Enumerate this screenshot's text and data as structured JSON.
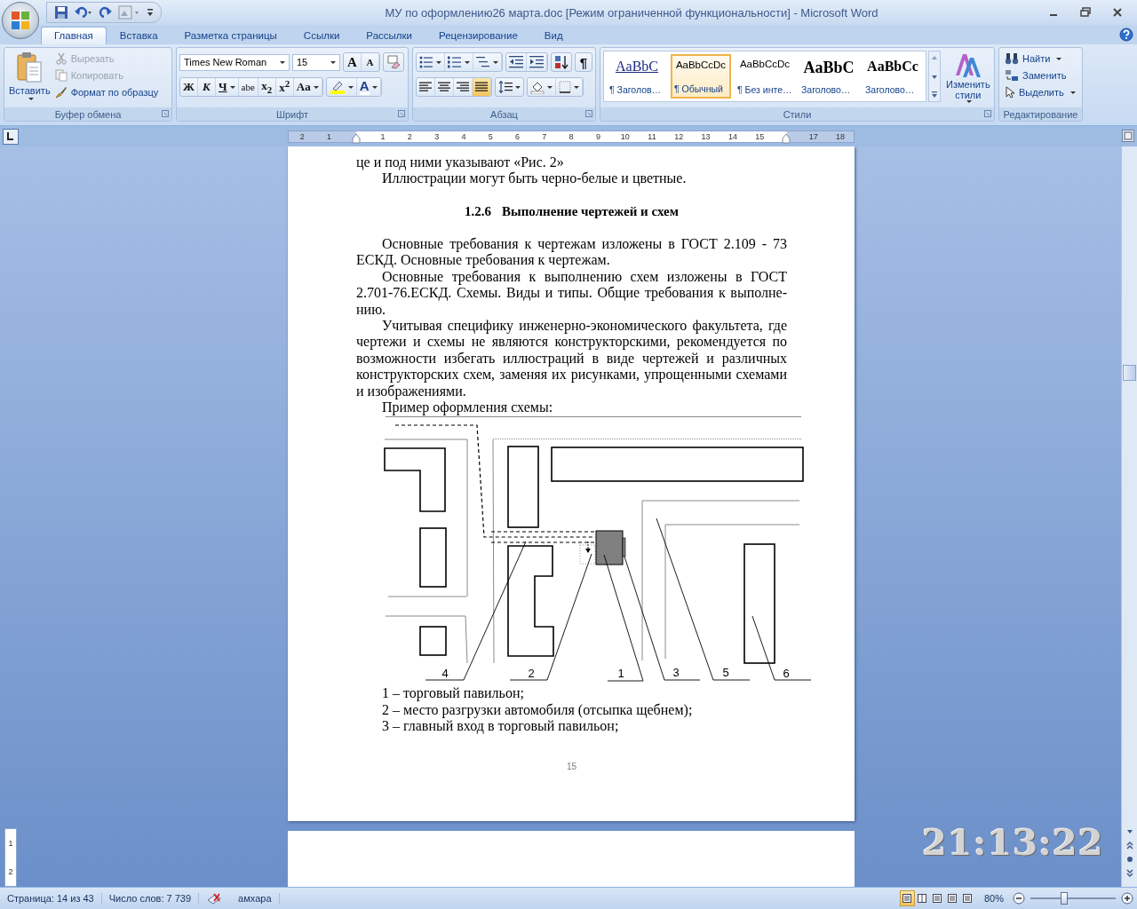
{
  "window": {
    "title": "МУ по оформлению26 марта.doc [Режим ограниченной функциональности] - Microsoft Word"
  },
  "tabs": [
    {
      "label": "Главная",
      "selected": true
    },
    {
      "label": "Вставка",
      "selected": false
    },
    {
      "label": "Разметка страницы",
      "selected": false
    },
    {
      "label": "Ссылки",
      "selected": false
    },
    {
      "label": "Рассылки",
      "selected": false
    },
    {
      "label": "Рецензирование",
      "selected": false
    },
    {
      "label": "Вид",
      "selected": false
    }
  ],
  "ribbon": {
    "clipboard": {
      "title": "Буфер обмена",
      "paste": "Вставить",
      "items": [
        {
          "label": "Вырезать",
          "kind": "cut",
          "disabled": true
        },
        {
          "label": "Копировать",
          "kind": "copy",
          "disabled": true
        },
        {
          "label": "Формат по образцу",
          "kind": "brush",
          "disabled": false
        }
      ]
    },
    "font": {
      "title": "Шрифт",
      "font_name": "Times New Roman",
      "font_size": "15",
      "size_buttons": [
        "A",
        "A"
      ],
      "format_buttons": [
        {
          "label": "Ж",
          "kind": "bold"
        },
        {
          "label": "К",
          "kind": "italic"
        },
        {
          "label": "Ч",
          "kind": "underline"
        },
        {
          "label": "abe",
          "kind": "strike"
        },
        {
          "label": "x$_{2}$",
          "kind": "sub"
        },
        {
          "label": "x$^{2}$",
          "kind": "sup"
        },
        {
          "label": "Aa",
          "kind": "case"
        }
      ],
      "color_button": "A"
    },
    "paragraph": {
      "title": "Абзац",
      "pilcrow": "¶",
      "alignment": [
        {
          "kind": "left",
          "selected": false
        },
        {
          "kind": "center",
          "selected": false
        },
        {
          "kind": "right",
          "selected": false
        },
        {
          "kind": "justify",
          "selected": true
        }
      ]
    },
    "styles": {
      "title": "Стили",
      "items": [
        {
          "sample": "AaBbC",
          "name": "¶ Заголов…",
          "kind": "heading1",
          "selected": false
        },
        {
          "sample": "AaBbCcDc",
          "name": "¶ Обычный",
          "kind": "normal",
          "selected": true
        },
        {
          "sample": "AaBbCcDc",
          "name": "¶ Без инте…",
          "kind": "normal",
          "selected": false
        },
        {
          "sample": "AaBbC",
          "name": "Заголово…",
          "kind": "heading2",
          "selected": false
        },
        {
          "sample": "AaBbCc",
          "name": "Заголово…",
          "kind": "heading3",
          "selected": false
        }
      ],
      "change_styles": "Изменить стили"
    },
    "editing": {
      "title": "Редактирование",
      "items": [
        {
          "label": "Найти",
          "kind": "find"
        },
        {
          "label": "Заменить",
          "kind": "replace"
        },
        {
          "label": "Выделить",
          "kind": "select"
        }
      ]
    }
  },
  "ruler": {
    "marks": [
      {
        "kind": "number",
        "label": "2"
      },
      {
        "kind": "number",
        "label": "1"
      },
      {
        "kind": "marker"
      },
      {
        "kind": "number",
        "label": "1"
      },
      {
        "kind": "number",
        "label": "2"
      },
      {
        "kind": "number",
        "label": "3"
      },
      {
        "kind": "number",
        "label": "4"
      },
      {
        "kind": "number",
        "label": "5"
      },
      {
        "kind": "number",
        "label": "6"
      },
      {
        "kind": "number",
        "label": "7"
      },
      {
        "kind": "number",
        "label": "8"
      },
      {
        "kind": "number",
        "label": "9"
      },
      {
        "kind": "number",
        "label": "10"
      },
      {
        "kind": "number",
        "label": "11"
      },
      {
        "kind": "number",
        "label": "12"
      },
      {
        "kind": "number",
        "label": "13"
      },
      {
        "kind": "number",
        "label": "14"
      },
      {
        "kind": "number",
        "label": "15"
      },
      {
        "kind": "marker"
      },
      {
        "kind": "number",
        "label": "17"
      },
      {
        "kind": "number",
        "label": "18"
      }
    ]
  },
  "document": {
    "paragraphs": [
      {
        "text": "це и под ними указывают «Рис. 2»",
        "indent": false
      },
      {
        "text": "Иллюстрации могут быть черно-белые и цветные.",
        "indent": true
      }
    ],
    "heading": {
      "number": "1.2.6",
      "title": "Выполнение чертежей и схем"
    },
    "body": [
      {
        "text": "Основные требования к чертежам изложены в ГОСТ 2.109 - 73 ЕСКД. Основные требования к чертежам.",
        "indent": true
      },
      {
        "text": "Основные требования к выполнению схем изложены в ГОСТ 2.701-76.ЕСКД. Схемы. Виды и типы. Общие требования к выполне-нию.",
        "indent": true
      },
      {
        "text": "Учитывая специфику инженерно-экономического факультета, где чертежи и схемы не являются конструкторскими, рекомендуется по возможности избегать иллюстраций в виде чертежей и различных конструкторских схем, заменяя их рисунками, упрощенными схемами и изображениями.",
        "indent": true
      },
      {
        "text": "Пример оформления схемы:",
        "indent": true
      }
    ],
    "diagram": {
      "labels": [
        "4",
        "2",
        "1",
        "3",
        "5",
        "6"
      ]
    },
    "legend": [
      "1 – торговый павильон;",
      "2 – место разгрузки автомобиля (отсыпка щебнем);",
      "3 – главный вход в торговый павильон;"
    ],
    "page_number": "15"
  },
  "vertical_ruler": {
    "labels": [
      "1",
      "2"
    ]
  },
  "status_bar": {
    "page": "Страница: 14 из 43",
    "words": "Число слов: 7 739",
    "language": "амхара",
    "views": [
      {
        "kind": "print",
        "selected": true
      },
      {
        "kind": "reading",
        "selected": false
      },
      {
        "kind": "web",
        "selected": false
      },
      {
        "kind": "outline",
        "selected": false
      },
      {
        "kind": "draft",
        "selected": false
      }
    ],
    "zoom": "80%",
    "zoom_slider": {
      "level": 0.4
    }
  },
  "clock_overlay": "21:13:22"
}
